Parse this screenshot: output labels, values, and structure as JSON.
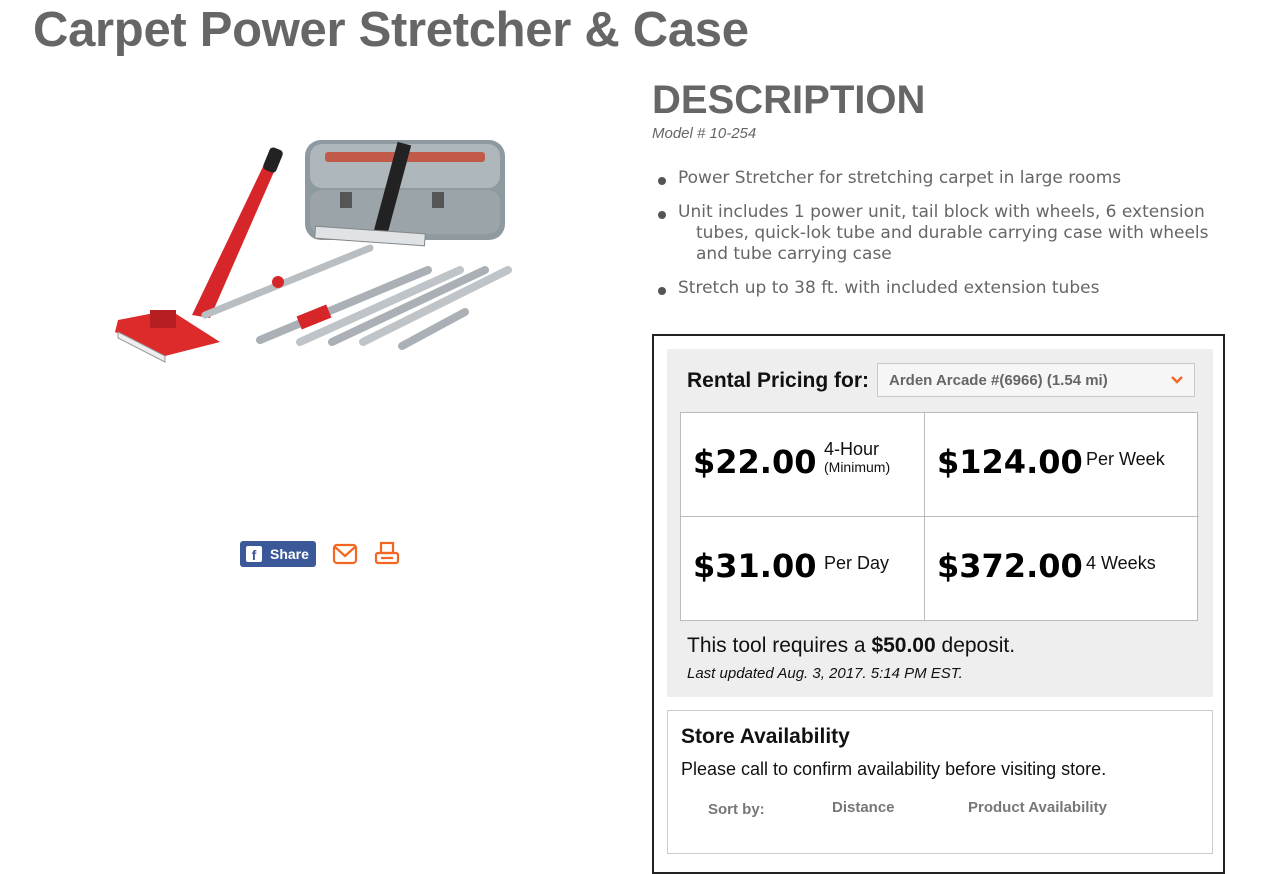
{
  "page": {
    "title": "Carpet Power Stretcher & Case"
  },
  "share": {
    "share_label": "Share",
    "icons": [
      "facebook-icon",
      "email-icon",
      "print-icon"
    ]
  },
  "description": {
    "heading": "DESCRIPTION",
    "model": "Model # 10-254",
    "features": [
      "Power Stretcher for stretching carpet in large rooms",
      "Unit includes 1 power unit, tail block with wheels, 6 extension tubes, quick-lok tube and durable carrying case with wheels and tube carrying case",
      "Stretch up to 38 ft. with included extension tubes"
    ]
  },
  "rental": {
    "label": "Rental Pricing for:",
    "store_selected": "Arden Arcade #(6966) (1.54 mi)",
    "prices": [
      {
        "amount": "$22.00",
        "period": "4-Hour",
        "note": "(Minimum)"
      },
      {
        "amount": "$124.00",
        "period": "Per Week",
        "note": ""
      },
      {
        "amount": "$31.00",
        "period": "Per Day",
        "note": ""
      },
      {
        "amount": "$372.00",
        "period": "4 Weeks",
        "note": ""
      }
    ],
    "deposit_prefix": "This tool requires a",
    "deposit_amount": "$50.00",
    "deposit_suffix": "deposit.",
    "last_updated": "Last updated Aug. 3, 2017. 5:14 PM EST."
  },
  "availability": {
    "title": "Store Availability",
    "message": "Please call to confirm availability before visiting store.",
    "sort_label": "Sort by:",
    "sort_options": [
      "Distance",
      "Product Availability"
    ]
  },
  "colors": {
    "heading_gray": "#666666",
    "facebook_blue": "#3b5998",
    "accent_orange": "#f26722",
    "panel_gray": "#eeeeee"
  }
}
